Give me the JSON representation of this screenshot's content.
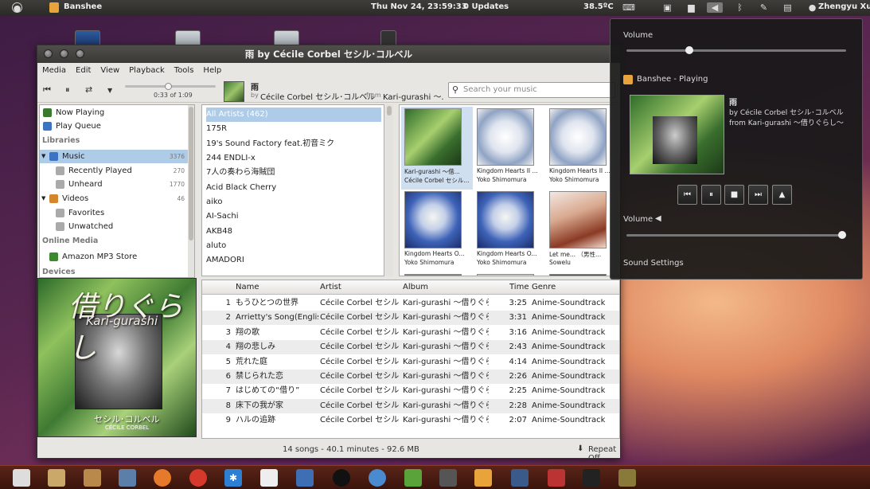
{
  "topbar": {
    "app_name": "Banshee",
    "datetime": "Thu Nov 24, 23:59:33",
    "updates": "0 Updates",
    "temperature": "38.5ºC",
    "user": "Zhengyu Xu"
  },
  "window": {
    "title": "雨 by Cécile Corbel セシル･コルベル",
    "menu": [
      "Media",
      "Edit",
      "View",
      "Playback",
      "Tools",
      "Help"
    ],
    "seek_time": "0:33 of 1:09",
    "seek_fraction": 0.48,
    "now_title": "雨",
    "now_by": "by",
    "now_artist": "Cécile Corbel セシル･コルベル",
    "now_from": "from",
    "now_album": "Kari-gurashi ～...",
    "search_placeholder": "Search your music"
  },
  "sidebar": {
    "now_playing": "Now Playing",
    "play_queue": "Play Queue",
    "libraries_header": "Libraries",
    "music": "Music",
    "music_count": "3376",
    "recently_played": "Recently Played",
    "recently_played_count": "270",
    "unheard": "Unheard",
    "unheard_count": "1770",
    "videos": "Videos",
    "videos_count": "46",
    "favorites": "Favorites",
    "unwatched": "Unwatched",
    "online_header": "Online Media",
    "amazon": "Amazon MP3 Store",
    "devices_header": "Devices"
  },
  "artists": [
    "All Artists (462)",
    "175R",
    "19's Sound Factory feat.初音ミク",
    "244 ENDLI-x",
    "7人の奏わら海賊団",
    "Acid Black Cherry",
    "aiko",
    "AI-Sachi",
    "AKB48",
    "aluto",
    "AMADORI"
  ],
  "albums": [
    {
      "title": "Kari-gurashi ～借...",
      "artist": "Cécile Corbel セシル...",
      "art": "kari"
    },
    {
      "title": "Kingdom Hearts II ...",
      "artist": "Yoko Shimomura",
      "art": "kh2"
    },
    {
      "title": "Kingdom Hearts II ...",
      "artist": "Yoko Shimomura",
      "art": "kh2"
    },
    {
      "title": "Kingdom Hearts O...",
      "artist": "Yoko Shimomura",
      "art": "kh"
    },
    {
      "title": "Kingdom Hearts O...",
      "artist": "Yoko Shimomura",
      "art": "kh"
    },
    {
      "title": "Let me... （男性...",
      "artist": "Sowelu",
      "art": "sow"
    }
  ],
  "big_art": {
    "jp_title": "借りぐらし",
    "latin_title": "Kari-gurashi",
    "artist_jp": "セシル･コルベル",
    "artist_latin": "CÉCILE CORBEL"
  },
  "track_columns": [
    "Name",
    "Artist",
    "Album",
    "Time",
    "Genre"
  ],
  "tracks": [
    {
      "n": "1",
      "name": "もうひとつの世界",
      "artist": "Cécile Corbel セシル...",
      "album": "Kari-gurashi ～借りぐら...",
      "time": "3:25",
      "genre": "Anime-Soundtrack"
    },
    {
      "n": "2",
      "name": "Arrietty's Song(Englis...",
      "artist": "Cécile Corbel セシル...",
      "album": "Kari-gurashi ～借りぐら...",
      "time": "3:31",
      "genre": "Anime-Soundtrack"
    },
    {
      "n": "3",
      "name": "翔の歌",
      "artist": "Cécile Corbel セシル...",
      "album": "Kari-gurashi ～借りぐら...",
      "time": "3:16",
      "genre": "Anime-Soundtrack"
    },
    {
      "n": "4",
      "name": "翔の悲しみ",
      "artist": "Cécile Corbel セシル...",
      "album": "Kari-gurashi ～借りぐら...",
      "time": "2:43",
      "genre": "Anime-Soundtrack"
    },
    {
      "n": "5",
      "name": "荒れた庭",
      "artist": "Cécile Corbel セシル...",
      "album": "Kari-gurashi ～借りぐら...",
      "time": "4:14",
      "genre": "Anime-Soundtrack"
    },
    {
      "n": "6",
      "name": "禁じられた恋",
      "artist": "Cécile Corbel セシル...",
      "album": "Kari-gurashi ～借りぐら...",
      "time": "2:26",
      "genre": "Anime-Soundtrack"
    },
    {
      "n": "7",
      "name": "はじめての“借り”",
      "artist": "Cécile Corbel セシル...",
      "album": "Kari-gurashi ～借りぐら...",
      "time": "2:25",
      "genre": "Anime-Soundtrack"
    },
    {
      "n": "8",
      "name": "床下の我が家",
      "artist": "Cécile Corbel セシル...",
      "album": "Kari-gurashi ～借りぐら...",
      "time": "2:28",
      "genre": "Anime-Soundtrack"
    },
    {
      "n": "9",
      "name": "ハルの追跡",
      "artist": "Cécile Corbel セシル...",
      "album": "Kari-gurashi ～借りぐら...",
      "time": "2:07",
      "genre": "Anime-Soundtrack"
    }
  ],
  "status": {
    "summary": "14 songs - 40.1 minutes - 92.6 MB",
    "repeat": "Repeat Off"
  },
  "popup": {
    "volume_label": "Volume",
    "volume_top_fraction": 0.28,
    "player_name": "Banshee - Playing",
    "track_title": "雨",
    "track_by": "by Cécile Corbel セシル･コルベル",
    "track_from": "from Kari-gurashi ～借りぐらし～",
    "volume2_label": "Volume",
    "volume2_fraction": 1.0,
    "sound_settings": "Sound Settings"
  },
  "clock": {
    "hours": "23",
    "minutes": "59"
  },
  "colors": {
    "selection": "#aecbe8",
    "accent": "#e07b39"
  }
}
